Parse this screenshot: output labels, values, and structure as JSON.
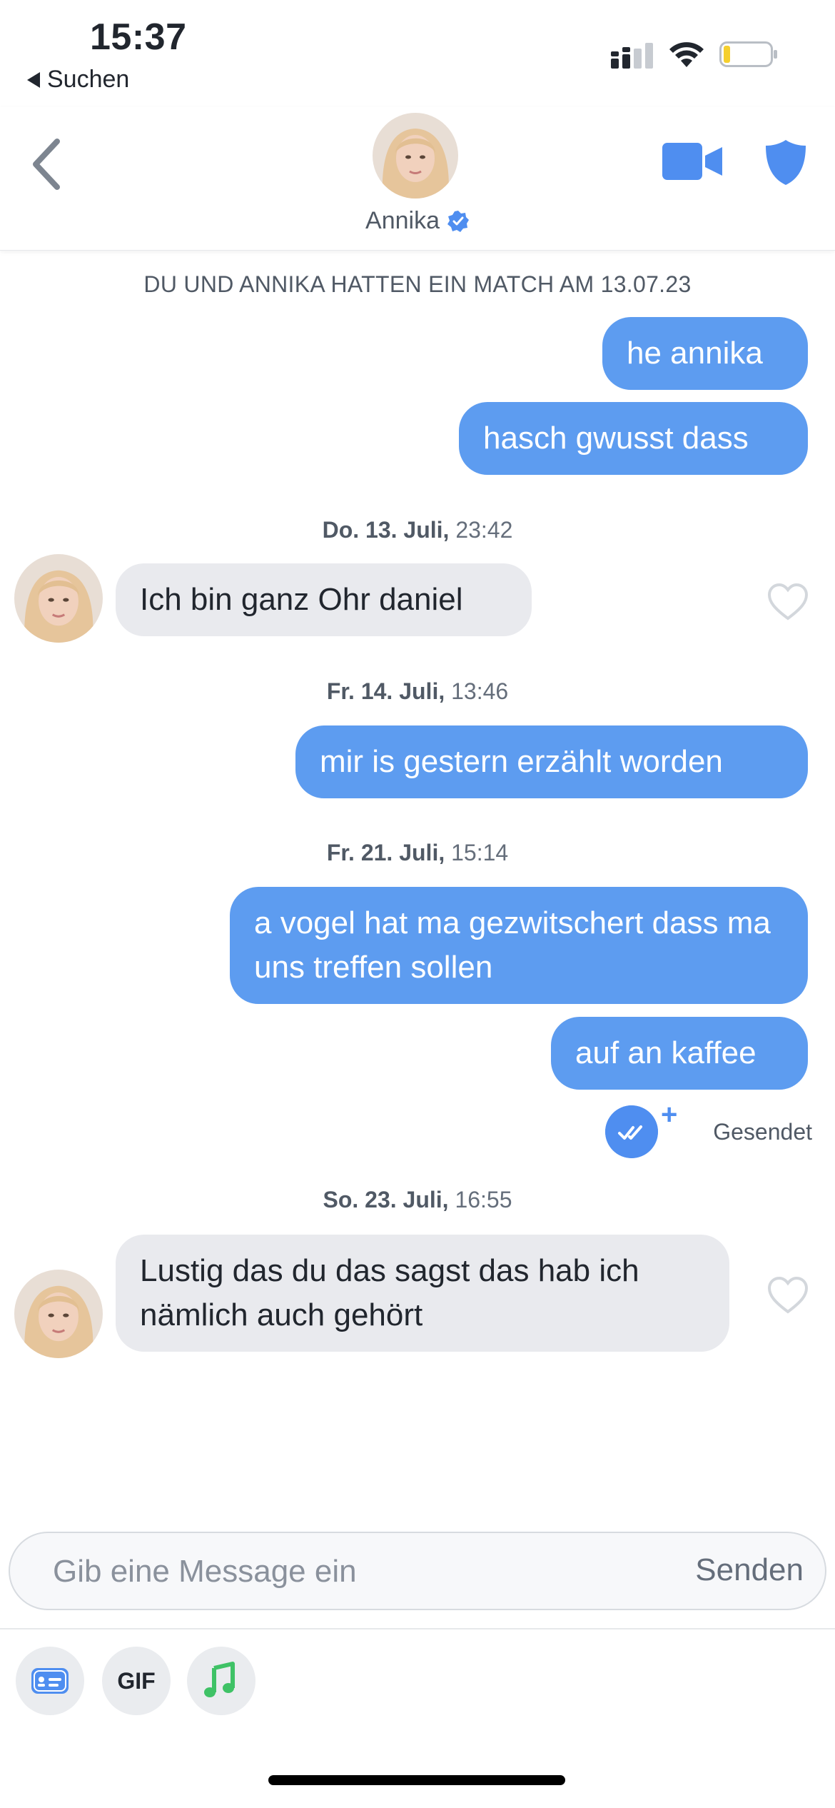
{
  "status": {
    "time": "15:37",
    "back_app": "Suchen"
  },
  "header": {
    "name": "Annika"
  },
  "chat": {
    "match_notice": "DU UND ANNIKA HATTEN EIN MATCH AM 13.07.23",
    "messages": [
      {
        "text": "he annika"
      },
      {
        "text": "hasch gwusst dass"
      },
      {
        "date_bold": "Do. 13. Juli,",
        "date_time": " 23:42"
      },
      {
        "text": "Ich bin ganz Ohr daniel"
      },
      {
        "date_bold": "Fr. 14. Juli,",
        "date_time": " 13:46"
      },
      {
        "text": "mir is gestern erzählt worden"
      },
      {
        "date_bold": "Fr. 21. Juli,",
        "date_time": " 15:14"
      },
      {
        "text": "a vogel hat ma gezwitschert dass ma uns treffen sollen"
      },
      {
        "text": "auf an kaffee"
      },
      {
        "status": "Gesendet"
      },
      {
        "date_bold": "So. 23. Juli,",
        "date_time": " 16:55"
      },
      {
        "text": "Lustig das du das sagst das hab ich nämlich auch gehört"
      }
    ]
  },
  "composer": {
    "placeholder": "Gib eine Message ein",
    "send_label": "Senden",
    "gif_label": "GIF"
  },
  "colors": {
    "accent": "#5d9cf0",
    "incoming_bubble": "#e9eaee",
    "icon_blue": "#4f8ef0"
  }
}
